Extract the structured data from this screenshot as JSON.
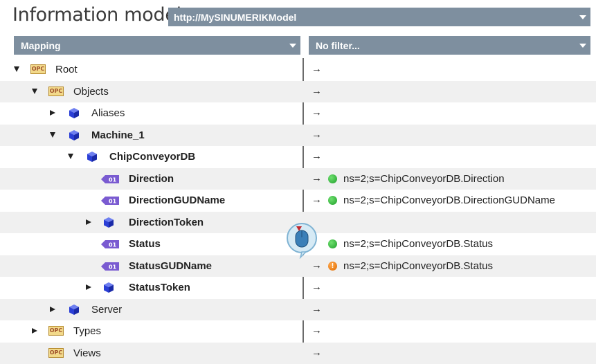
{
  "header": {
    "title": "Information model",
    "model_url": "http://MySINUMERIKModel"
  },
  "columns": {
    "mapping_label": "Mapping",
    "filter_label": "No filter..."
  },
  "tree": [
    {
      "label": "Root",
      "icon": "opc-folder-icon",
      "expand": "down",
      "bold": false,
      "mapping": "",
      "status": ""
    },
    {
      "label": "Objects",
      "icon": "opc-folder-icon",
      "expand": "down",
      "bold": false,
      "mapping": "",
      "status": ""
    },
    {
      "label": "Aliases",
      "icon": "object-cube-icon",
      "expand": "right",
      "bold": false,
      "mapping": "",
      "status": ""
    },
    {
      "label": "Machine_1",
      "icon": "object-cube-icon",
      "expand": "down",
      "bold": true,
      "mapping": "",
      "status": ""
    },
    {
      "label": "ChipConveyorDB",
      "icon": "object-cube-icon",
      "expand": "down",
      "bold": true,
      "mapping": "",
      "status": ""
    },
    {
      "label": "Direction",
      "icon": "variable-icon",
      "expand": "",
      "bold": true,
      "mapping": "ns=2;s=ChipConveyorDB.Direction",
      "status": "ok"
    },
    {
      "label": "DirectionGUDName",
      "icon": "variable-icon",
      "expand": "",
      "bold": true,
      "mapping": "ns=2;s=ChipConveyorDB.DirectionGUDName",
      "status": "ok"
    },
    {
      "label": "DirectionToken",
      "icon": "object-cube-icon",
      "expand": "right",
      "bold": true,
      "mapping": "",
      "status": ""
    },
    {
      "label": "Status",
      "icon": "variable-icon",
      "expand": "",
      "bold": true,
      "mapping": "ns=2;s=ChipConveyorDB.Status",
      "status": "ok"
    },
    {
      "label": "StatusGUDName",
      "icon": "variable-icon",
      "expand": "",
      "bold": true,
      "mapping": "ns=2;s=ChipConveyorDB.Status",
      "status": "warn"
    },
    {
      "label": "StatusToken",
      "icon": "object-cube-icon",
      "expand": "right",
      "bold": true,
      "mapping": "",
      "status": ""
    },
    {
      "label": "Server",
      "icon": "object-cube-icon",
      "expand": "right",
      "bold": false,
      "mapping": "",
      "status": ""
    },
    {
      "label": "Types",
      "icon": "opc-folder-icon",
      "expand": "right",
      "bold": false,
      "mapping": "",
      "status": ""
    },
    {
      "label": "Views",
      "icon": "opc-folder-icon",
      "expand": "",
      "bold": false,
      "mapping": "",
      "status": ""
    }
  ],
  "icons": {
    "opc_text": "OPC",
    "var_text": "01",
    "arrow": "→",
    "warn_text": "!"
  },
  "colors": {
    "header_bar": "#7e8f9f",
    "status_ok": "#1e9e2a",
    "status_warn": "#e06b00",
    "cube": "#2b3fd6",
    "variable": "#7a5bd1"
  }
}
